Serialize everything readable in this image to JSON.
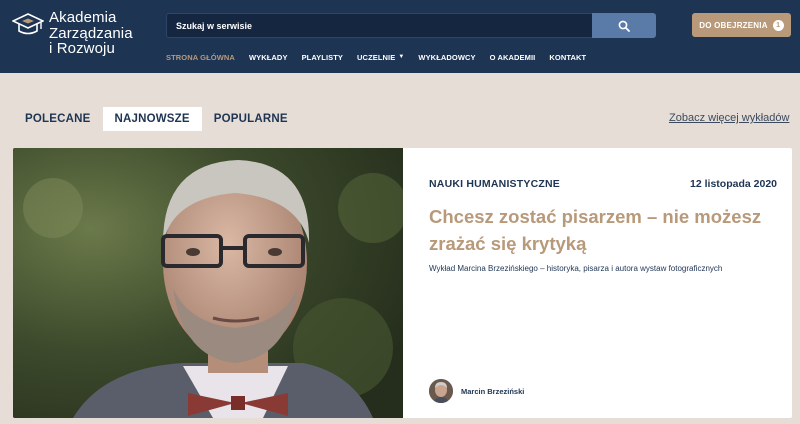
{
  "brand": {
    "name_line1": "Akademia",
    "name_line2": "Zarządzania",
    "name_line3": "i Rozwoju",
    "logo_icon": "graduation-cap-icon"
  },
  "search": {
    "placeholder": "Szukaj w serwisie",
    "button_icon": "search-icon"
  },
  "watch_later": {
    "label": "DO OBEJRZENIA",
    "count": "1"
  },
  "nav": {
    "items": [
      {
        "label": "STRONA GŁÓWNA",
        "active": true
      },
      {
        "label": "WYKŁADY"
      },
      {
        "label": "PLAYLISTY"
      },
      {
        "label": "UCZELNIE",
        "has_dropdown": true
      },
      {
        "label": "WYKŁADOWCY"
      },
      {
        "label": "O AKADEMII"
      },
      {
        "label": "KONTAKT"
      }
    ]
  },
  "tabs": {
    "items": [
      {
        "label": "POLECANE"
      },
      {
        "label": "NAJNOWSZE",
        "active": true
      },
      {
        "label": "POPULARNE"
      }
    ],
    "more_link": "Zobacz więcej wykładów"
  },
  "featured": {
    "category": "NAUKI HUMANISTYCZNE",
    "date": "12 listopada 2020",
    "title": "Chcesz zostać pisarzem – nie możesz zrażać się krytyką",
    "description": "Wykład Marcina Brzezińskiego – historyka, pisarza i autora wystaw fotograficznych",
    "author": "Marcin Brzeziński"
  },
  "colors": {
    "header_bg": "#1e3453",
    "accent": "#b8997a",
    "page_bg": "#e6ded6",
    "search_btn": "#5a7aa8"
  }
}
